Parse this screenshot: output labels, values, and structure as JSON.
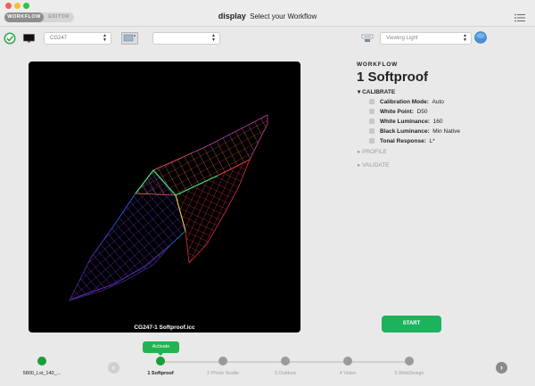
{
  "titlebar": {
    "tabs": [
      {
        "label": "WORKFLOW",
        "active": true
      },
      {
        "label": "EDITOR",
        "active": false
      }
    ],
    "app_name": "display",
    "subtitle": "Select your Workflow",
    "menu_icon": "list-icon"
  },
  "toolbar": {
    "status_icon": "check-circle-icon",
    "display_icon": "monitor-icon",
    "display_select_value": "CG247",
    "profile_icon": "display-profile-icon",
    "profile_select_value": "",
    "light_icon": "lux-meter-icon",
    "light_select_placeholder": "Viewing Light",
    "globe_icon": "globe-icon"
  },
  "viewer": {
    "caption": "CG247-1 Softproof.icc"
  },
  "workflow": {
    "label": "WORKFLOW",
    "title": "1 Softproof",
    "calibrate": {
      "label": "CALIBRATE",
      "properties": [
        {
          "key": "Calibration Mode:",
          "value": "Auto"
        },
        {
          "key": "White Point:",
          "value": "D50"
        },
        {
          "key": "White Luminance:",
          "value": "160"
        },
        {
          "key": "Black Luminance:",
          "value": "Min Native"
        },
        {
          "key": "Tonal Response:",
          "value": "L*"
        }
      ]
    },
    "profile_label": "PROFILE",
    "validate_label": "VALIDATE",
    "start_label": "START"
  },
  "timeline": {
    "device_label": "5800_Lst_140_...",
    "activate_label": "Activate",
    "steps": [
      {
        "label": "1 Softproof",
        "active": true
      },
      {
        "label": "2 Photo Studio",
        "active": false
      },
      {
        "label": "3 Outdoor",
        "active": false
      },
      {
        "label": "4 Video",
        "active": false
      },
      {
        "label": "5 WebDesign",
        "active": false
      }
    ]
  },
  "colors": {
    "accent_green": "#1db35c",
    "node_green": "#1a9e3a",
    "inactive_gray": "#9a9a9a"
  }
}
